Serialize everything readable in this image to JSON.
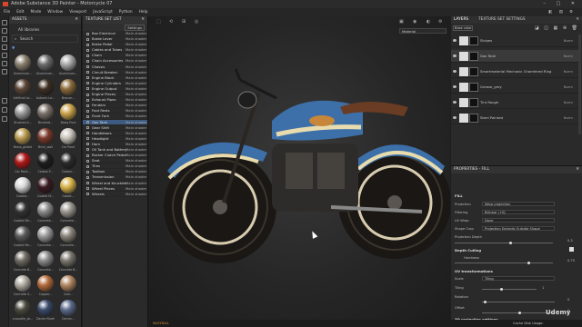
{
  "window": {
    "title": "Adobe Substance 3D Painter - Motorcycle 07",
    "controls": "– □ ✕"
  },
  "menu": [
    "File",
    "Edit",
    "Mode",
    "Window",
    "Viewport",
    "JavaScript",
    "Python",
    "Help"
  ],
  "assets": {
    "title": "ASSETS",
    "filter": "All libraries",
    "search_placeholder": "Search",
    "materials": [
      "Aluminium...",
      "Aluminium...",
      "Aluminium...",
      "Artificial Le...",
      "Autumn Le...",
      "Bronze...",
      "Brushed A...",
      "Brushed...",
      "Brass Pure",
      "Brass_gilded",
      "Brick_wall",
      "Car Paint",
      "Car Paint...",
      "Carbon F...",
      "Carbon...",
      "Coated...",
      "Coated M...",
      "Cobalt...",
      "Coated Me...",
      "Concrete...",
      "Concrete...",
      "Coated Me...",
      "Concrete...",
      "Concrete...",
      "Concrete B...",
      "Concrete...",
      "Concrete B...",
      "Concrete S...",
      "Copper...",
      "Cork...",
      "crocodile_sk...",
      "Denim Rivet",
      "Denim..."
    ],
    "colors": [
      "#8a7f6e",
      "#6b6b6b",
      "#a8a8a8",
      "#5a4535",
      "#3d2f22",
      "#8a6a3a",
      "#9a9a9a",
      "#7a7068",
      "#c9a24a",
      "#b89a50",
      "#7a3a2a",
      "#c8c2b8",
      "#b01818",
      "#1d1d1d",
      "#2a2a2a",
      "#d8d8d8",
      "#3a1a22",
      "#d6b24a",
      "#333333",
      "#8a8a8a",
      "#9a968e",
      "#5a5a5a",
      "#9a9a9a",
      "#8a847a",
      "#6d6a62",
      "#8a8a8a",
      "#7a766e",
      "#b0aaa0",
      "#b36a3a",
      "#b08660",
      "#4a4a3e",
      "#3a4a6a",
      "#5a6a8a"
    ]
  },
  "texture_set_list": {
    "title": "TEXTURE SET LIST",
    "settings_label": "Settings",
    "items": [
      {
        "name": "Box Electrical",
        "shader": "Main shader"
      },
      {
        "name": "Brake Lever",
        "shader": "Main shader"
      },
      {
        "name": "Brake Pedal",
        "shader": "Main shader"
      },
      {
        "name": "Cables and Tubes",
        "shader": "Main shader"
      },
      {
        "name": "Chain",
        "shader": "Main shader"
      },
      {
        "name": "Chain Accessories",
        "shader": "Main shader"
      },
      {
        "name": "Chassis",
        "shader": "Main shader"
      },
      {
        "name": "Circuit Breaker",
        "shader": "Main shader"
      },
      {
        "name": "Engine Block",
        "shader": "Main shader"
      },
      {
        "name": "Engine Cylinders",
        "shader": "Main shader"
      },
      {
        "name": "Engine Output",
        "shader": "Main shader"
      },
      {
        "name": "Engine Pieces",
        "shader": "Main shader"
      },
      {
        "name": "Exhaust Pipes",
        "shader": "Main shader"
      },
      {
        "name": "Fenders",
        "shader": "Main shader"
      },
      {
        "name": "Foot Rests",
        "shader": "Main shader"
      },
      {
        "name": "Front Fork",
        "shader": "Main shader"
      },
      {
        "name": "Gas Tank",
        "shader": "Main shader",
        "selected": true
      },
      {
        "name": "Gear Shift",
        "shader": "Main shader"
      },
      {
        "name": "Handlebars",
        "shader": "Main shader"
      },
      {
        "name": "Headlight",
        "shader": "Main shader"
      },
      {
        "name": "Horn",
        "shader": "Main shader"
      },
      {
        "name": "Oil Tank and Battery",
        "shader": "Main shader"
      },
      {
        "name": "Rocker Clutch Pedal",
        "shader": "Main shader"
      },
      {
        "name": "Seat",
        "shader": "Main shader"
      },
      {
        "name": "Tires",
        "shader": "Main shader"
      },
      {
        "name": "Toolbox",
        "shader": "Main shader"
      },
      {
        "name": "Transmission",
        "shader": "Main shader"
      },
      {
        "name": "Wheel and Knuckles",
        "shader": "Main shader"
      },
      {
        "name": "Wheel Pieces",
        "shader": "Main shader"
      },
      {
        "name": "Wheels",
        "shader": "Main shader"
      }
    ]
  },
  "viewport": {
    "mode": "Material"
  },
  "layers": {
    "tab_layers": "LAYERS",
    "tab_tss": "TEXTURE SET SETTINGS",
    "channel": "Base color",
    "items": [
      {
        "name": "Stripes",
        "blend": "Norm",
        "opacity": "100"
      },
      {
        "name": "Gas Tank",
        "blend": "Norm",
        "opacity": "100",
        "selected": true
      },
      {
        "name": "Smartmaterial Mechanic Chamfered Ring",
        "blend": "Norm",
        "opacity": "100"
      },
      {
        "name": "Grease_grey",
        "blend": "Norm",
        "opacity": "100"
      },
      {
        "name": "Tint Rough",
        "blend": "Norm",
        "opacity": "100"
      },
      {
        "name": "Steel Painted",
        "blend": "Norm",
        "opacity": "100"
      }
    ]
  },
  "properties": {
    "title": "PROPERTIES - FILL",
    "section_fill": "FILL",
    "projection_label": "Projection",
    "projection_value": "Warp projection",
    "filtering_label": "Filtering",
    "filtering_value": "Bilinear | HQ",
    "uvwrap_label": "UV Wrap",
    "uvwrap_value": "None",
    "shape_crop_label": "Shape Crop",
    "shape_crop_value": "Projection Extends Outside Shape",
    "proj_depth_label": "Projection Depth",
    "proj_depth_value": "0.3",
    "depth_culling": "Depth Culling",
    "hardness_label": "Hardness",
    "hardness_value": "0.75",
    "hardness_level": 0.75,
    "uv_transform": "UV transformations",
    "scale_label": "Scale",
    "scale_value": "Tiling",
    "tiling_label": "Tiling",
    "tiling_value": "1",
    "rotation_label": "Rotation",
    "rotation_value": "0",
    "offset_label": "Offset",
    "offset_value": "0",
    "proj3d": "3D projection settings",
    "material": "MATERIAL"
  },
  "status": {
    "cache": "Cache Disk Usage:",
    "version": "Version: 8.3.0",
    "watermark": "Udemy"
  }
}
